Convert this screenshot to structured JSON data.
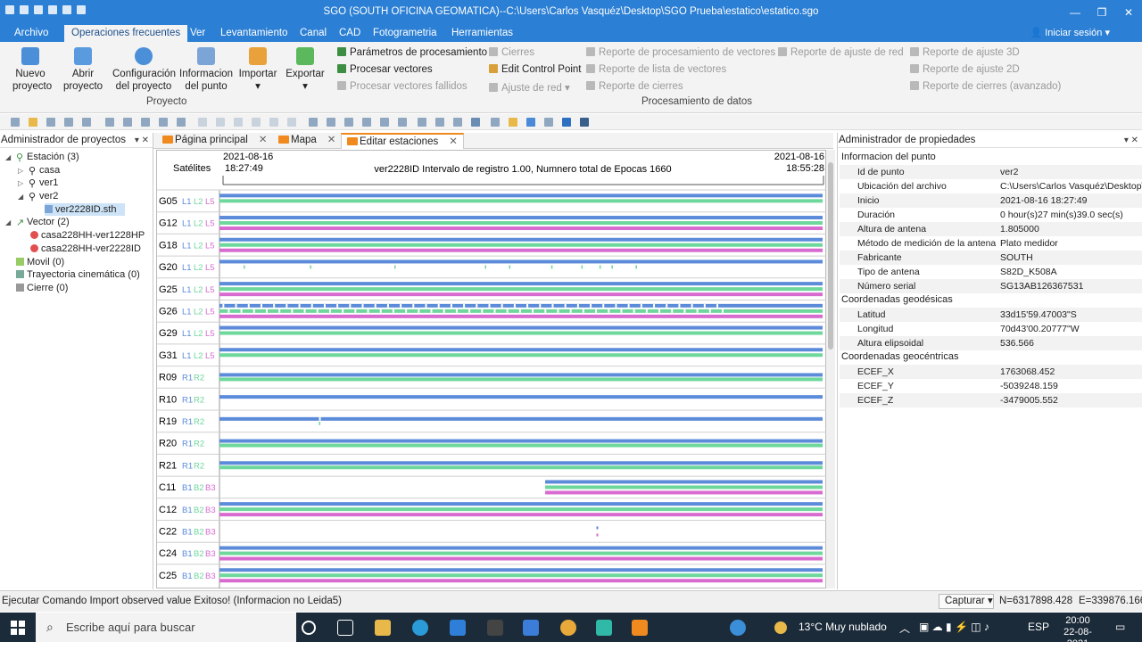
{
  "window": {
    "title": "SGO (SOUTH OFICINA GEOMATICA)--C:\\Users\\Carlos Vasquéz\\Desktop\\SGO Prueba\\estatico\\estatico.sgo"
  },
  "menu": {
    "items": [
      "Archivo",
      "Operaciones frecuentes",
      "Ver",
      "Levantamiento",
      "Canal",
      "CAD",
      "Fotogrametria",
      "Herramientas"
    ],
    "login": "Iniciar sesión"
  },
  "ribbon": {
    "project": {
      "new": "Nuevo proyecto",
      "open": "Abrir proyecto",
      "config": "Configuración del proyecto",
      "info": "Informacion del punto",
      "import": "Importar",
      "export": "Exportar",
      "label": "Proyecto"
    },
    "processing": {
      "label": "Procesamiento de datos",
      "params": "Parámetros de procesamiento",
      "process": "Procesar vectores",
      "failed": "Procesar vectores fallidos",
      "closures": "Cierres",
      "edit_cp": "Edit Control Point",
      "net_adj": "Ajuste de red",
      "rep_vec": "Reporte de procesamiento de vectores",
      "rep_list": "Reporte de lista de vectores",
      "rep_closures": "Reporte de cierres",
      "rep_net": "Reporte de ajuste de red",
      "rep_3d": "Reporte de ajuste 3D",
      "rep_2d": "Reporte de ajuste 2D",
      "rep_adv": "Reporte de cierres (avanzado)"
    }
  },
  "left_panel": {
    "title": "Administrador de proyectos",
    "tree": {
      "estacion": "Estación (3)",
      "casa": "casa",
      "ver1": "ver1",
      "ver2": "ver2",
      "file": "ver2228ID.sth",
      "vector": "Vector (2)",
      "v1": "casa228HH-ver1228HP",
      "v2": "casa228HH-ver2228ID",
      "movil": "Movil (0)",
      "tray": "Trayectoria cinemática (0)",
      "cierre": "Cierre (0)"
    }
  },
  "tabs": [
    "Página principal",
    "Mapa",
    "Editar estaciones"
  ],
  "chart_header": {
    "start_date": "2021-08-16",
    "start_time": "18:27:49",
    "end_date": "2021-08-16",
    "end_time": "18:55:28",
    "sat_label": "Satélites",
    "info": "ver2228ID Intervalo de registro 1.00, Numnero total de Epocas 1660"
  },
  "chart_data": {
    "type": "timeline",
    "colors": {
      "L1": "#5b8bd9",
      "L2": "#6ed79b",
      "L5": "#d86bd0",
      "B3": "#d86bd0",
      "R1": "#5b8bd9",
      "R2": "#6ed79b",
      "B1": "#5b8bd9",
      "B2": "#6ed79b"
    },
    "x_range": [
      0,
      1660
    ],
    "rows": [
      {
        "sat": "G05",
        "bands": [
          "L1",
          "L2",
          "L5"
        ],
        "segments": [
          [
            0,
            1
          ],
          [
            0,
            1
          ]
        ]
      },
      {
        "sat": "G12",
        "bands": [
          "L1",
          "L2",
          "L5"
        ],
        "segments": [
          [
            0,
            1
          ],
          [
            0,
            1
          ],
          [
            0,
            1
          ]
        ]
      },
      {
        "sat": "G18",
        "bands": [
          "L1",
          "L2",
          "L5"
        ],
        "segments": [
          [
            0,
            1
          ],
          [
            0,
            1
          ],
          [
            0,
            1
          ]
        ]
      },
      {
        "sat": "G20",
        "bands": [
          "L1",
          "L2",
          "L5"
        ],
        "segments": [
          [
            0,
            1
          ]
        ],
        "gaps": [
          0.04,
          0.15,
          0.29,
          0.44,
          0.48,
          0.55,
          0.6,
          0.63,
          0.65,
          0.69
        ]
      },
      {
        "sat": "G25",
        "bands": [
          "L1",
          "L2",
          "L5"
        ],
        "segments": [
          [
            0,
            1
          ],
          [
            0,
            1
          ],
          [
            0,
            1
          ]
        ]
      },
      {
        "sat": "G26",
        "bands": [
          "L1",
          "L2",
          "L5"
        ],
        "segments": [
          [
            0,
            1
          ],
          [
            0,
            1
          ],
          [
            0,
            1
          ]
        ],
        "broken": true
      },
      {
        "sat": "G29",
        "bands": [
          "L1",
          "L2",
          "L5"
        ],
        "segments": [
          [
            0,
            1
          ],
          [
            0,
            1
          ]
        ]
      },
      {
        "sat": "G31",
        "bands": [
          "L1",
          "L2",
          "L5"
        ],
        "segments": [
          [
            0,
            1
          ],
          [
            0,
            1
          ]
        ]
      },
      {
        "sat": "R09",
        "bands": [
          "R1",
          "R2"
        ],
        "segments": [
          [
            0,
            1
          ],
          [
            0,
            1
          ]
        ]
      },
      {
        "sat": "R10",
        "bands": [
          "R1",
          "R2"
        ],
        "segments": [
          [
            0,
            1
          ]
        ]
      },
      {
        "sat": "R19",
        "bands": [
          "R1",
          "R2"
        ],
        "segments": [
          [
            0,
            1
          ]
        ],
        "gaps": [
          0.165
        ]
      },
      {
        "sat": "R20",
        "bands": [
          "R1",
          "R2"
        ],
        "segments": [
          [
            0,
            1
          ],
          [
            0,
            1
          ]
        ]
      },
      {
        "sat": "R21",
        "bands": [
          "R1",
          "R2"
        ],
        "segments": [
          [
            0,
            1
          ],
          [
            0,
            1
          ]
        ]
      },
      {
        "sat": "C11",
        "bands": [
          "B1",
          "B2",
          "B3"
        ],
        "segments": [
          [
            0.54,
            1
          ],
          [
            0.54,
            1
          ],
          [
            0.54,
            1
          ]
        ]
      },
      {
        "sat": "C12",
        "bands": [
          "B1",
          "B2",
          "B3"
        ],
        "segments": [
          [
            0,
            1
          ],
          [
            0,
            1
          ],
          [
            0,
            1
          ]
        ]
      },
      {
        "sat": "C22",
        "bands": [
          "B1",
          "B2",
          "B3"
        ],
        "segments": [],
        "dots": [
          0.625
        ]
      },
      {
        "sat": "C24",
        "bands": [
          "B1",
          "B2",
          "B3"
        ],
        "segments": [
          [
            0,
            1
          ],
          [
            0,
            1
          ],
          [
            0,
            1
          ]
        ]
      },
      {
        "sat": "C25",
        "bands": [
          "B1",
          "B2",
          "B3"
        ],
        "segments": [
          [
            0,
            1
          ],
          [
            0,
            1
          ],
          [
            0,
            1
          ]
        ]
      }
    ]
  },
  "right_panel": {
    "title": "Administrador de propiedades",
    "sec1": "Informacion del punto",
    "rows1": [
      [
        "Id de punto",
        "ver2"
      ],
      [
        "Ubicación del archivo",
        "C:\\Users\\Carlos Vasquéz\\Desktop\\..."
      ],
      [
        "Inicio",
        "2021-08-16 18:27:49"
      ],
      [
        "Duración",
        "0 hour(s)27 min(s)39.0 sec(s)"
      ],
      [
        "Altura de antena",
        "1.805000"
      ],
      [
        "Método de medición de la antena",
        "Plato medidor"
      ],
      [
        "Fabricante",
        "SOUTH"
      ],
      [
        "Tipo de antena",
        "S82D_K508A"
      ],
      [
        "Número serial",
        "SG13AB126367531"
      ]
    ],
    "sec2": "Coordenadas geodésicas",
    "rows2": [
      [
        "Latitud",
        "33d15'59.47003\"S"
      ],
      [
        "Longitud",
        "70d43'00.20777\"W"
      ],
      [
        "Altura elipsoidal",
        "536.566"
      ]
    ],
    "sec3": "Coordenadas geocéntricas",
    "rows3": [
      [
        "ECEF_X",
        "1763068.452"
      ],
      [
        "ECEF_Y",
        "-5039248.159"
      ],
      [
        "ECEF_Z",
        "-3479005.552"
      ]
    ]
  },
  "status": {
    "message": "Ejecutar Comando Import observed value Exitoso! (Informacion no Leida5)",
    "capture": "Capturar",
    "north": "N=6317898.428",
    "east": "E=339876.166"
  },
  "taskbar": {
    "search": "Escribe aquí para buscar",
    "weather": "13°C  Muy nublado",
    "lang": "ESP",
    "time": "20:00",
    "date": "22-08-2021"
  }
}
